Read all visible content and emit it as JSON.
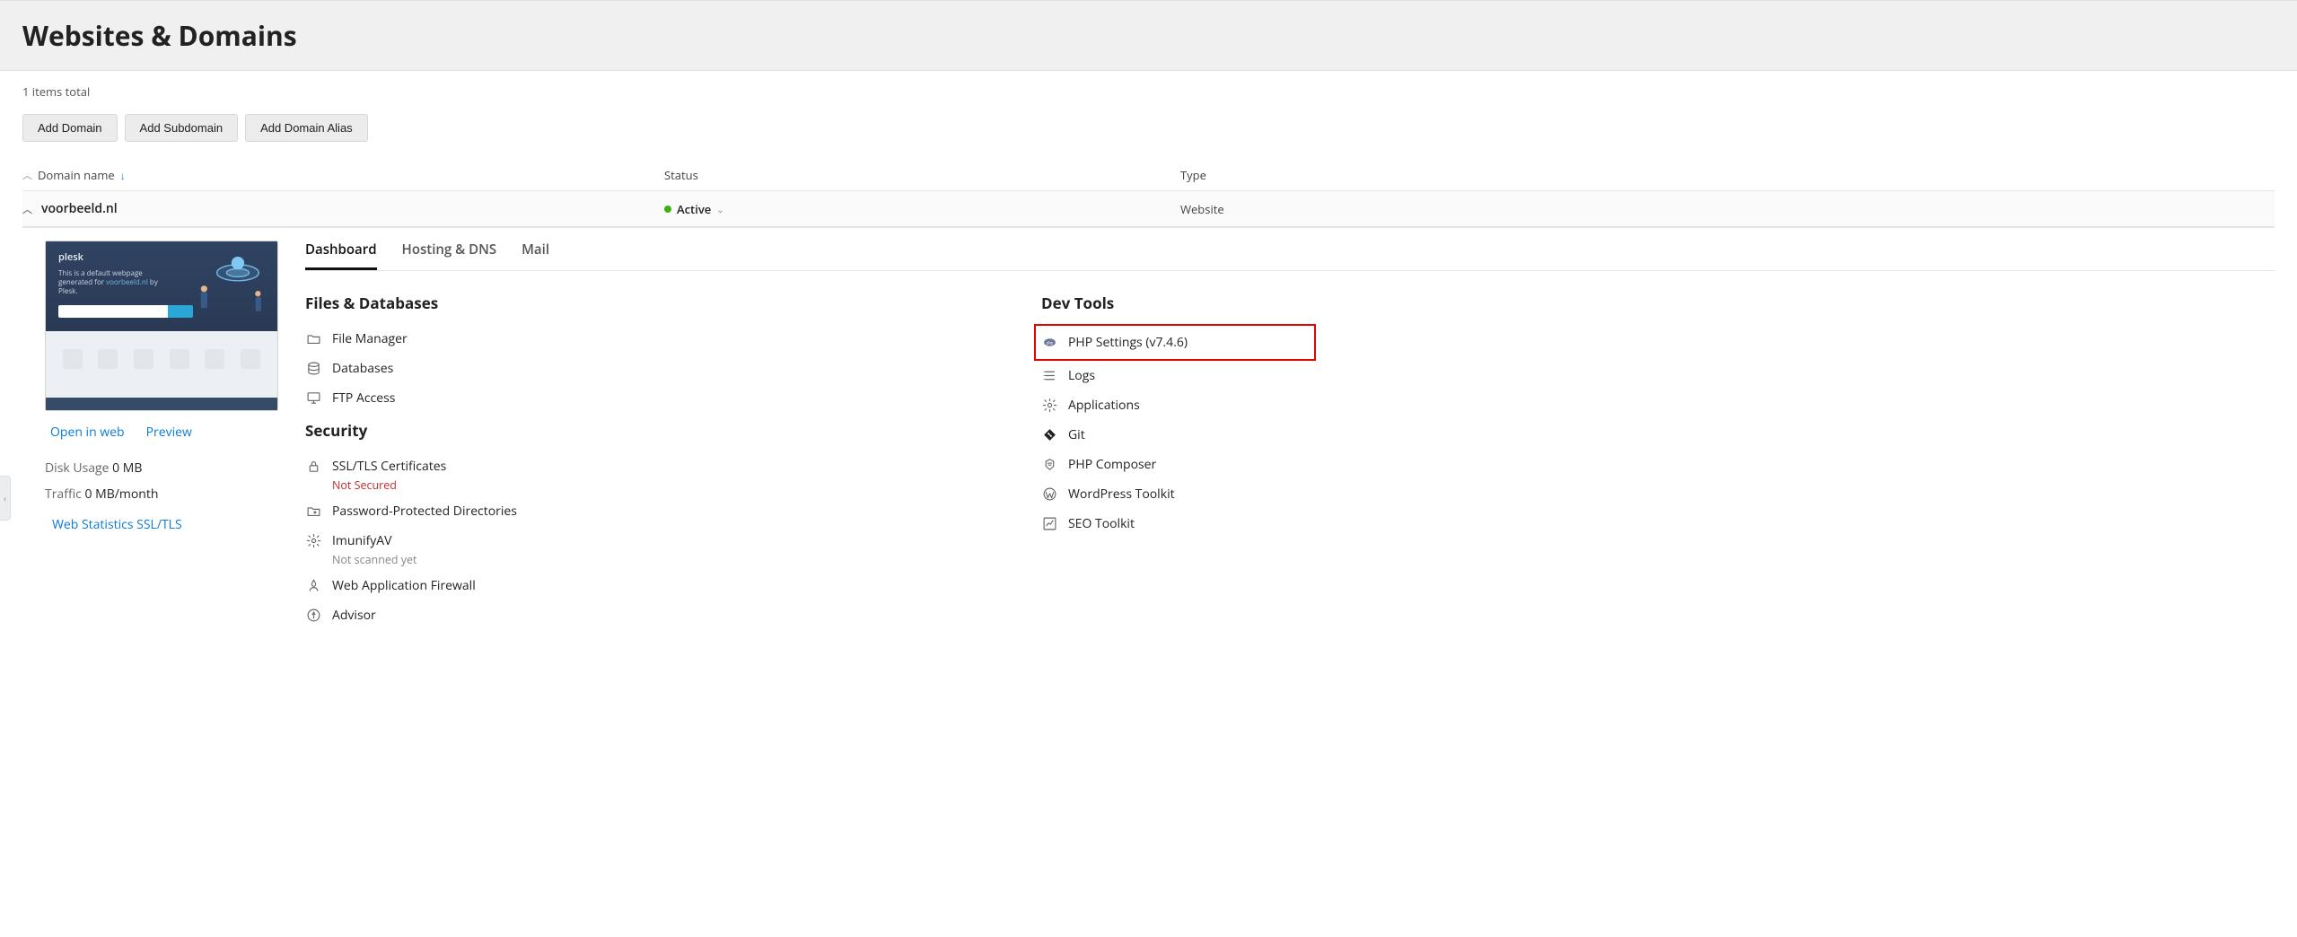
{
  "page_title": "Websites & Domains",
  "items_total": "1 items total",
  "toolbar": {
    "add_domain": "Add Domain",
    "add_subdomain": "Add Subdomain",
    "add_domain_alias": "Add Domain Alias"
  },
  "table": {
    "columns": {
      "domain": "Domain name",
      "status": "Status",
      "type": "Type"
    }
  },
  "domain": {
    "name": "voorbeeld.nl",
    "status": "Active",
    "type": "Website"
  },
  "left": {
    "open_in_web": "Open in web",
    "preview": "Preview",
    "disk_usage_label": "Disk Usage",
    "disk_usage_value": "0 MB",
    "traffic_label": "Traffic",
    "traffic_value": "0 MB/month",
    "web_stats": "Web Statistics SSL/TLS"
  },
  "tabs": {
    "dashboard": "Dashboard",
    "hosting_dns": "Hosting & DNS",
    "mail": "Mail"
  },
  "sections": {
    "files_db": {
      "title": "Files & Databases",
      "file_manager": "File Manager",
      "databases": "Databases",
      "ftp_access": "FTP Access"
    },
    "security": {
      "title": "Security",
      "ssl": "SSL/TLS Certificates",
      "ssl_status": "Not Secured",
      "pwprotect": "Password-Protected Directories",
      "imunify": "ImunifyAV",
      "imunify_status": "Not scanned yet",
      "waf": "Web Application Firewall",
      "advisor": "Advisor"
    },
    "devtools": {
      "title": "Dev Tools",
      "php_settings": "PHP Settings (v7.4.6)",
      "logs": "Logs",
      "applications": "Applications",
      "git": "Git",
      "composer": "PHP Composer",
      "wp_toolkit": "WordPress Toolkit",
      "seo_toolkit": "SEO Toolkit"
    }
  }
}
